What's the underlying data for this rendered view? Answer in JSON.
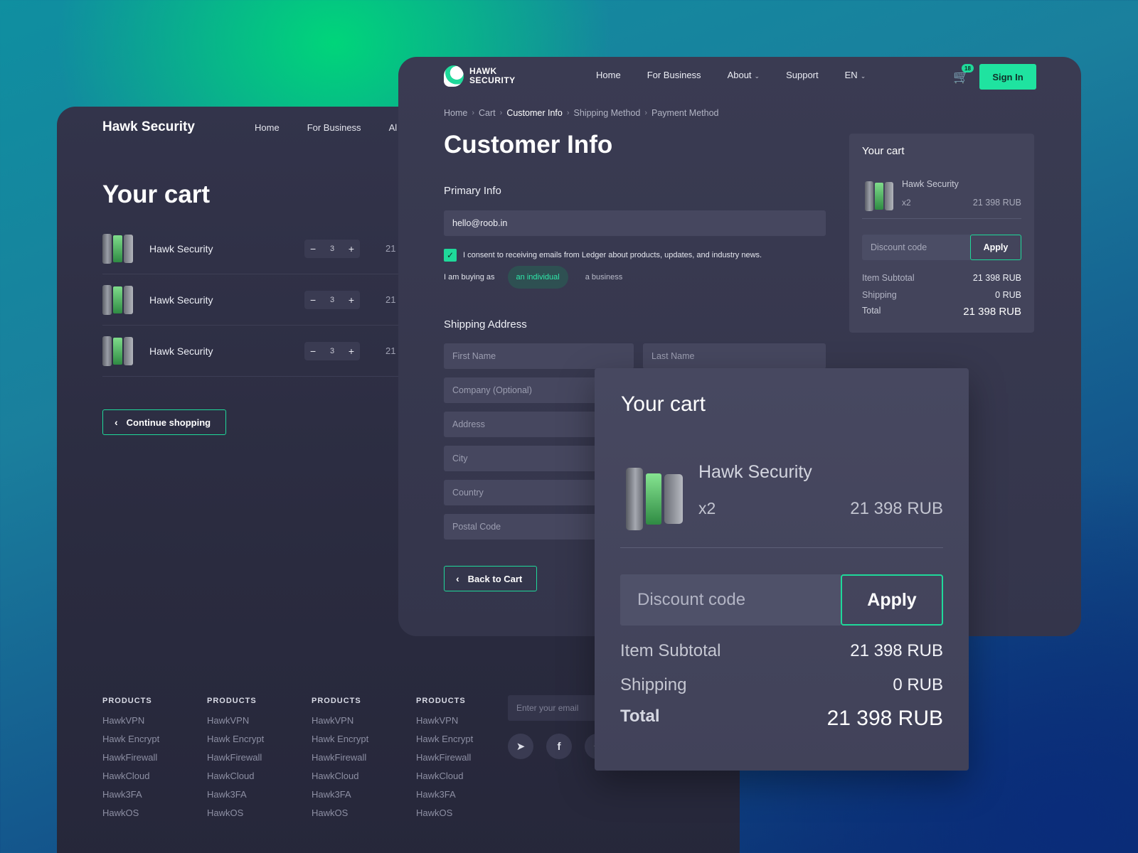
{
  "back": {
    "brand": "Hawk Security",
    "nav": [
      "Home",
      "For Business",
      "Al"
    ],
    "title": "Your cart",
    "items": [
      {
        "name": "Hawk Security",
        "qty": "3",
        "price": "21 :"
      },
      {
        "name": "Hawk Security",
        "qty": "3",
        "price": "21 :"
      },
      {
        "name": "Hawk Security",
        "qty": "3",
        "price": "21 :"
      }
    ],
    "continue_label": "Continue shopping",
    "footer": {
      "columns": [
        {
          "heading": "PRODUCTS",
          "links": [
            "HawkVPN",
            "Hawk Encrypt",
            "HawkFirewall",
            "HawkCloud",
            "Hawk3FA",
            "HawkOS"
          ]
        },
        {
          "heading": "PRODUCTS",
          "links": [
            "HawkVPN",
            "Hawk Encrypt",
            "HawkFirewall",
            "HawkCloud",
            "Hawk3FA",
            "HawkOS"
          ]
        },
        {
          "heading": "PRODUCTS",
          "links": [
            "HawkVPN",
            "Hawk Encrypt",
            "HawkFirewall",
            "HawkCloud",
            "Hawk3FA",
            "HawkOS"
          ]
        },
        {
          "heading": "PRODUCTS",
          "links": [
            "HawkVPN",
            "Hawk Encrypt",
            "HawkFirewall",
            "HawkCloud",
            "Hawk3FA",
            "HawkOS"
          ]
        }
      ],
      "email_placeholder": "Enter your email",
      "socials": [
        "telegram-icon",
        "facebook-icon",
        "twitter-icon"
      ]
    }
  },
  "front": {
    "logo_line1": "HAWK",
    "logo_line2": "SECURITY",
    "nav": {
      "home": "Home",
      "business": "For Business",
      "about": "About",
      "support": "Support",
      "lang": "EN"
    },
    "cart_count": "18",
    "signin": "Sign In",
    "breadcrumb": [
      "Home",
      "Cart",
      "Customer Info",
      "Shipping Method",
      "Payment Method"
    ],
    "title": "Customer Info",
    "primary_heading": "Primary Info",
    "email_value": "hello@roob.in",
    "consent_text": "I consent to receiving emails from Ledger about products, updates, and industry news.",
    "buying_label": "I am buying as",
    "buying_options": [
      "an individual",
      "a business"
    ],
    "shipping_heading": "Shipping Address",
    "placeholders": {
      "first_name": "First Name",
      "last_name": "Last Name",
      "company": "Company (Optional)",
      "address": "Address",
      "city": "City",
      "country": "Country",
      "postal": "Postal Code"
    },
    "back_label": "Back to Cart",
    "side_cart": {
      "title": "Your cart",
      "item_name": "Hawk Security",
      "item_qty": "x2",
      "item_price": "21 398 RUB",
      "discount_placeholder": "Discount code",
      "apply": "Apply",
      "subtotal_label": "Item Subtotal",
      "subtotal": "21 398 RUB",
      "shipping_label": "Shipping",
      "shipping": "0 RUB",
      "total_label": "Total",
      "total": "21 398 RUB"
    }
  },
  "zoom": {
    "title": "Your cart",
    "item_name": "Hawk Security",
    "item_qty": "x2",
    "item_price": "21 398 RUB",
    "discount_placeholder": "Discount code",
    "apply": "Apply",
    "subtotal_label": "Item Subtotal",
    "subtotal": "21 398 RUB",
    "shipping_label": "Shipping",
    "shipping": "0 RUB",
    "total_label": "Total",
    "total": "21 398 RUB"
  },
  "colors": {
    "accent": "#1fd99a",
    "panel": "#3a3b52",
    "background_green": "#00d57a",
    "background_blue": "#0a2d6e"
  }
}
